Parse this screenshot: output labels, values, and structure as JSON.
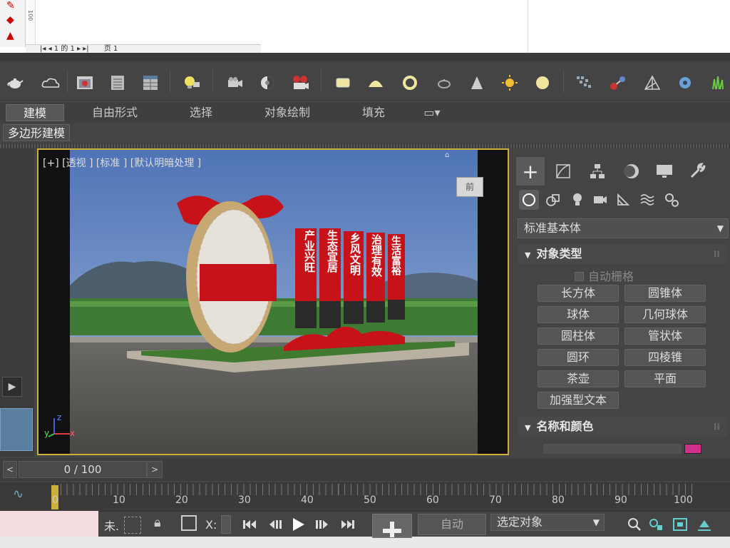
{
  "toolbar_top": {
    "doc": {
      "page_nav": "1 的 1",
      "page_label": "页 1",
      "ruler_label": "100"
    }
  },
  "ribbon": {
    "tabs": [
      "建模",
      "自由形式",
      "选择",
      "对象绘制",
      "填充"
    ],
    "active_tab": "建模",
    "subtab": "多边形建模"
  },
  "viewport": {
    "label": "[+] [透视 ] [标准 ] [默认明暗处理 ]",
    "panels": [
      "产业兴旺",
      "生态宜居",
      "乡风文明",
      "治理有效",
      "生活富裕"
    ],
    "viewcube_label": "前",
    "axis": {
      "x": "x",
      "y": "y",
      "z": "z"
    }
  },
  "command_panel": {
    "category_dropdown": "标准基本体",
    "object_type_title": "对象类型",
    "autogrid_label": "自动栅格",
    "buttons": [
      "长方体",
      "圆锥体",
      "球体",
      "几何球体",
      "圆柱体",
      "管状体",
      "圆环",
      "四棱锥",
      "茶壶",
      "平面",
      "加强型文本"
    ],
    "name_color_title": "名称和颜色",
    "color": "#d0308a"
  },
  "time_slider": {
    "value": "0 / 100",
    "prev": "<",
    "next": ">"
  },
  "track": {
    "ticks": [
      "0",
      "10",
      "20",
      "30",
      "40",
      "50",
      "60",
      "70",
      "80",
      "90",
      "100"
    ]
  },
  "status": {
    "prompt": "未.",
    "x_label": "X:",
    "auto_label": "自动",
    "select_dropdown": "选定对象"
  },
  "colors": {
    "accent": "#c8b03a",
    "panel_red": "#c8121a",
    "sky": "#6f8fc4"
  }
}
